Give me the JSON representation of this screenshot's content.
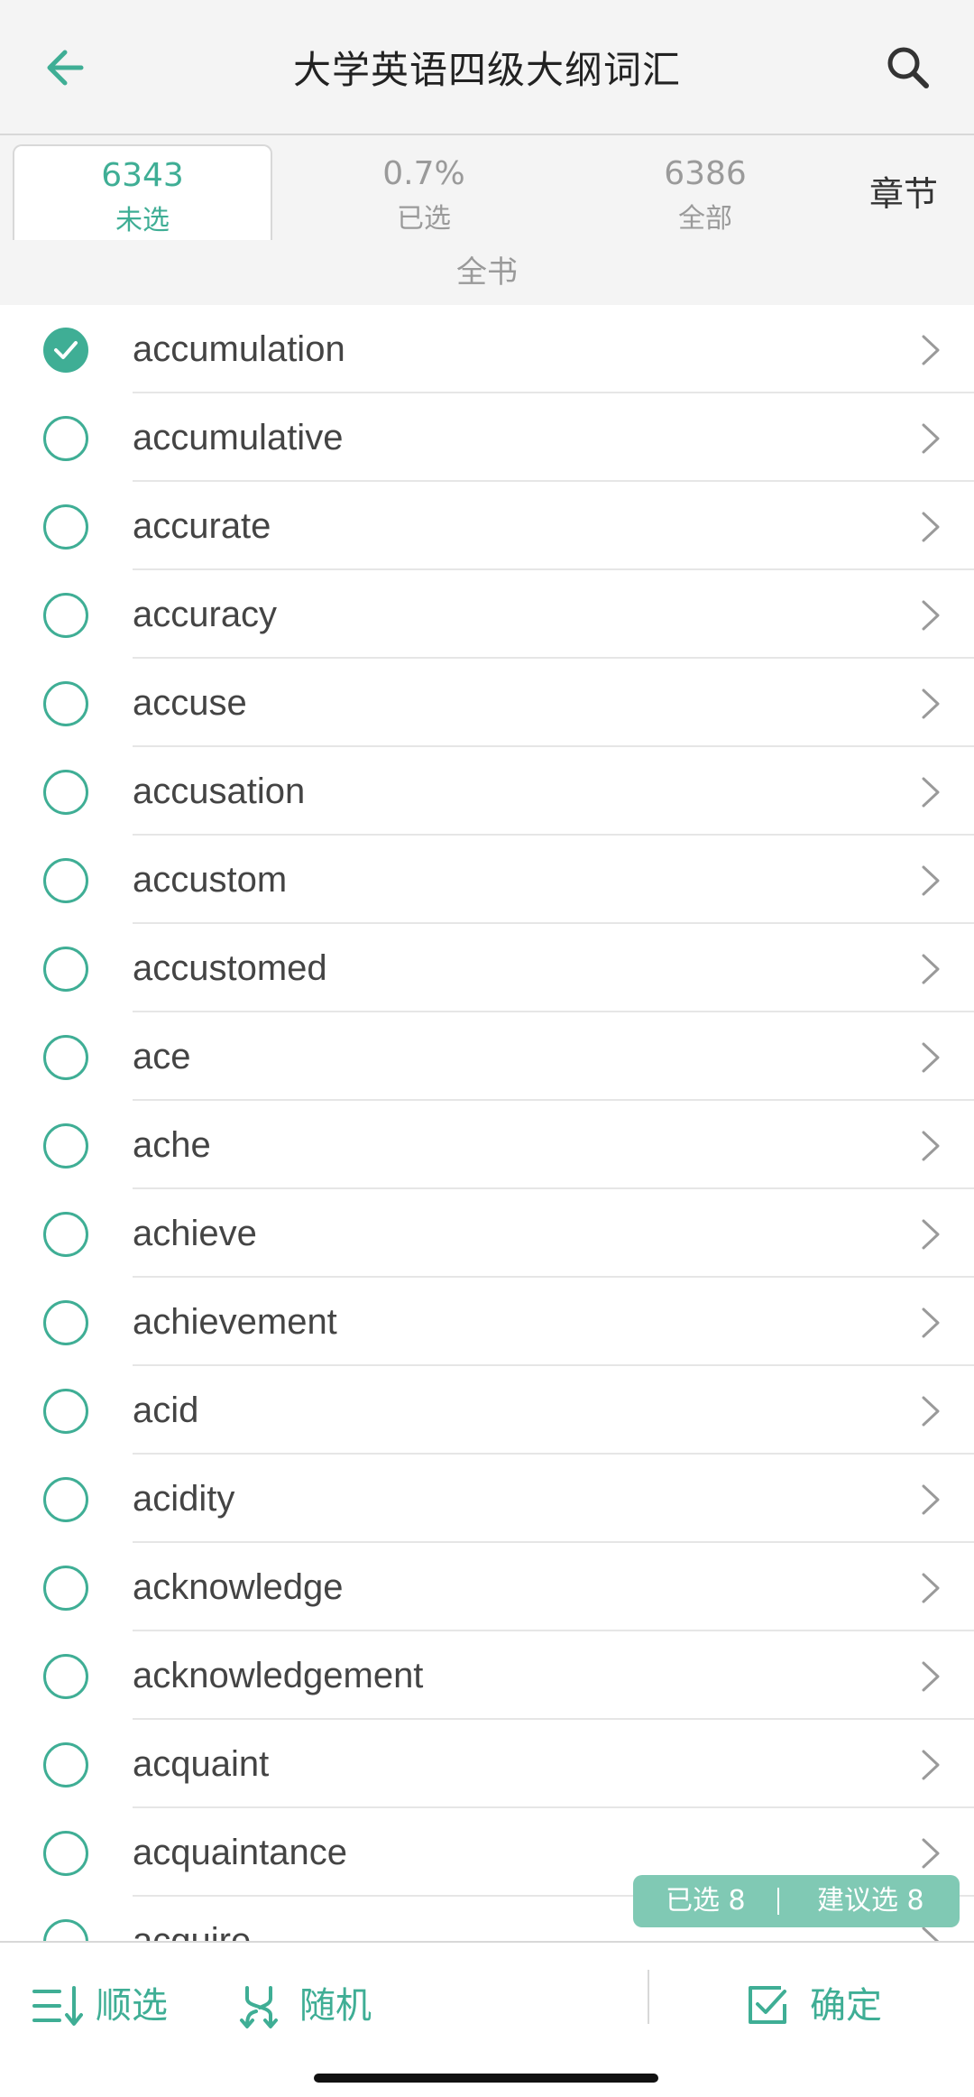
{
  "header": {
    "title": "大学英语四级大纲词汇",
    "back_icon": "arrow-left-icon",
    "search_icon": "search-icon"
  },
  "tabs": [
    {
      "number": "6343",
      "label": "未选",
      "active": true
    },
    {
      "number": "0.7%",
      "label": "已选",
      "active": false
    },
    {
      "number": "6386",
      "label": "全部",
      "active": false
    }
  ],
  "chapter_label": "章节",
  "section_label": "全书",
  "words": [
    {
      "text": "accumulation",
      "checked": true
    },
    {
      "text": "accumulative",
      "checked": false
    },
    {
      "text": "accurate",
      "checked": false
    },
    {
      "text": "accuracy",
      "checked": false
    },
    {
      "text": "accuse",
      "checked": false
    },
    {
      "text": "accusation",
      "checked": false
    },
    {
      "text": "accustom",
      "checked": false
    },
    {
      "text": "accustomed",
      "checked": false
    },
    {
      "text": "ace",
      "checked": false
    },
    {
      "text": "ache",
      "checked": false
    },
    {
      "text": "achieve",
      "checked": false
    },
    {
      "text": "achievement",
      "checked": false
    },
    {
      "text": "acid",
      "checked": false
    },
    {
      "text": "acidity",
      "checked": false
    },
    {
      "text": "acknowledge",
      "checked": false
    },
    {
      "text": "acknowledgement",
      "checked": false
    },
    {
      "text": "acquaint",
      "checked": false
    },
    {
      "text": "acquaintance",
      "checked": false
    },
    {
      "text": "acquire",
      "checked": false
    }
  ],
  "badge": {
    "selected": "已选 8",
    "suggested": "建议选 8"
  },
  "bottom_bar": {
    "sequential_label": "顺选",
    "random_label": "随机",
    "confirm_label": "确定"
  },
  "colors": {
    "accent": "#3fae95",
    "badge": "#80c9b4"
  }
}
